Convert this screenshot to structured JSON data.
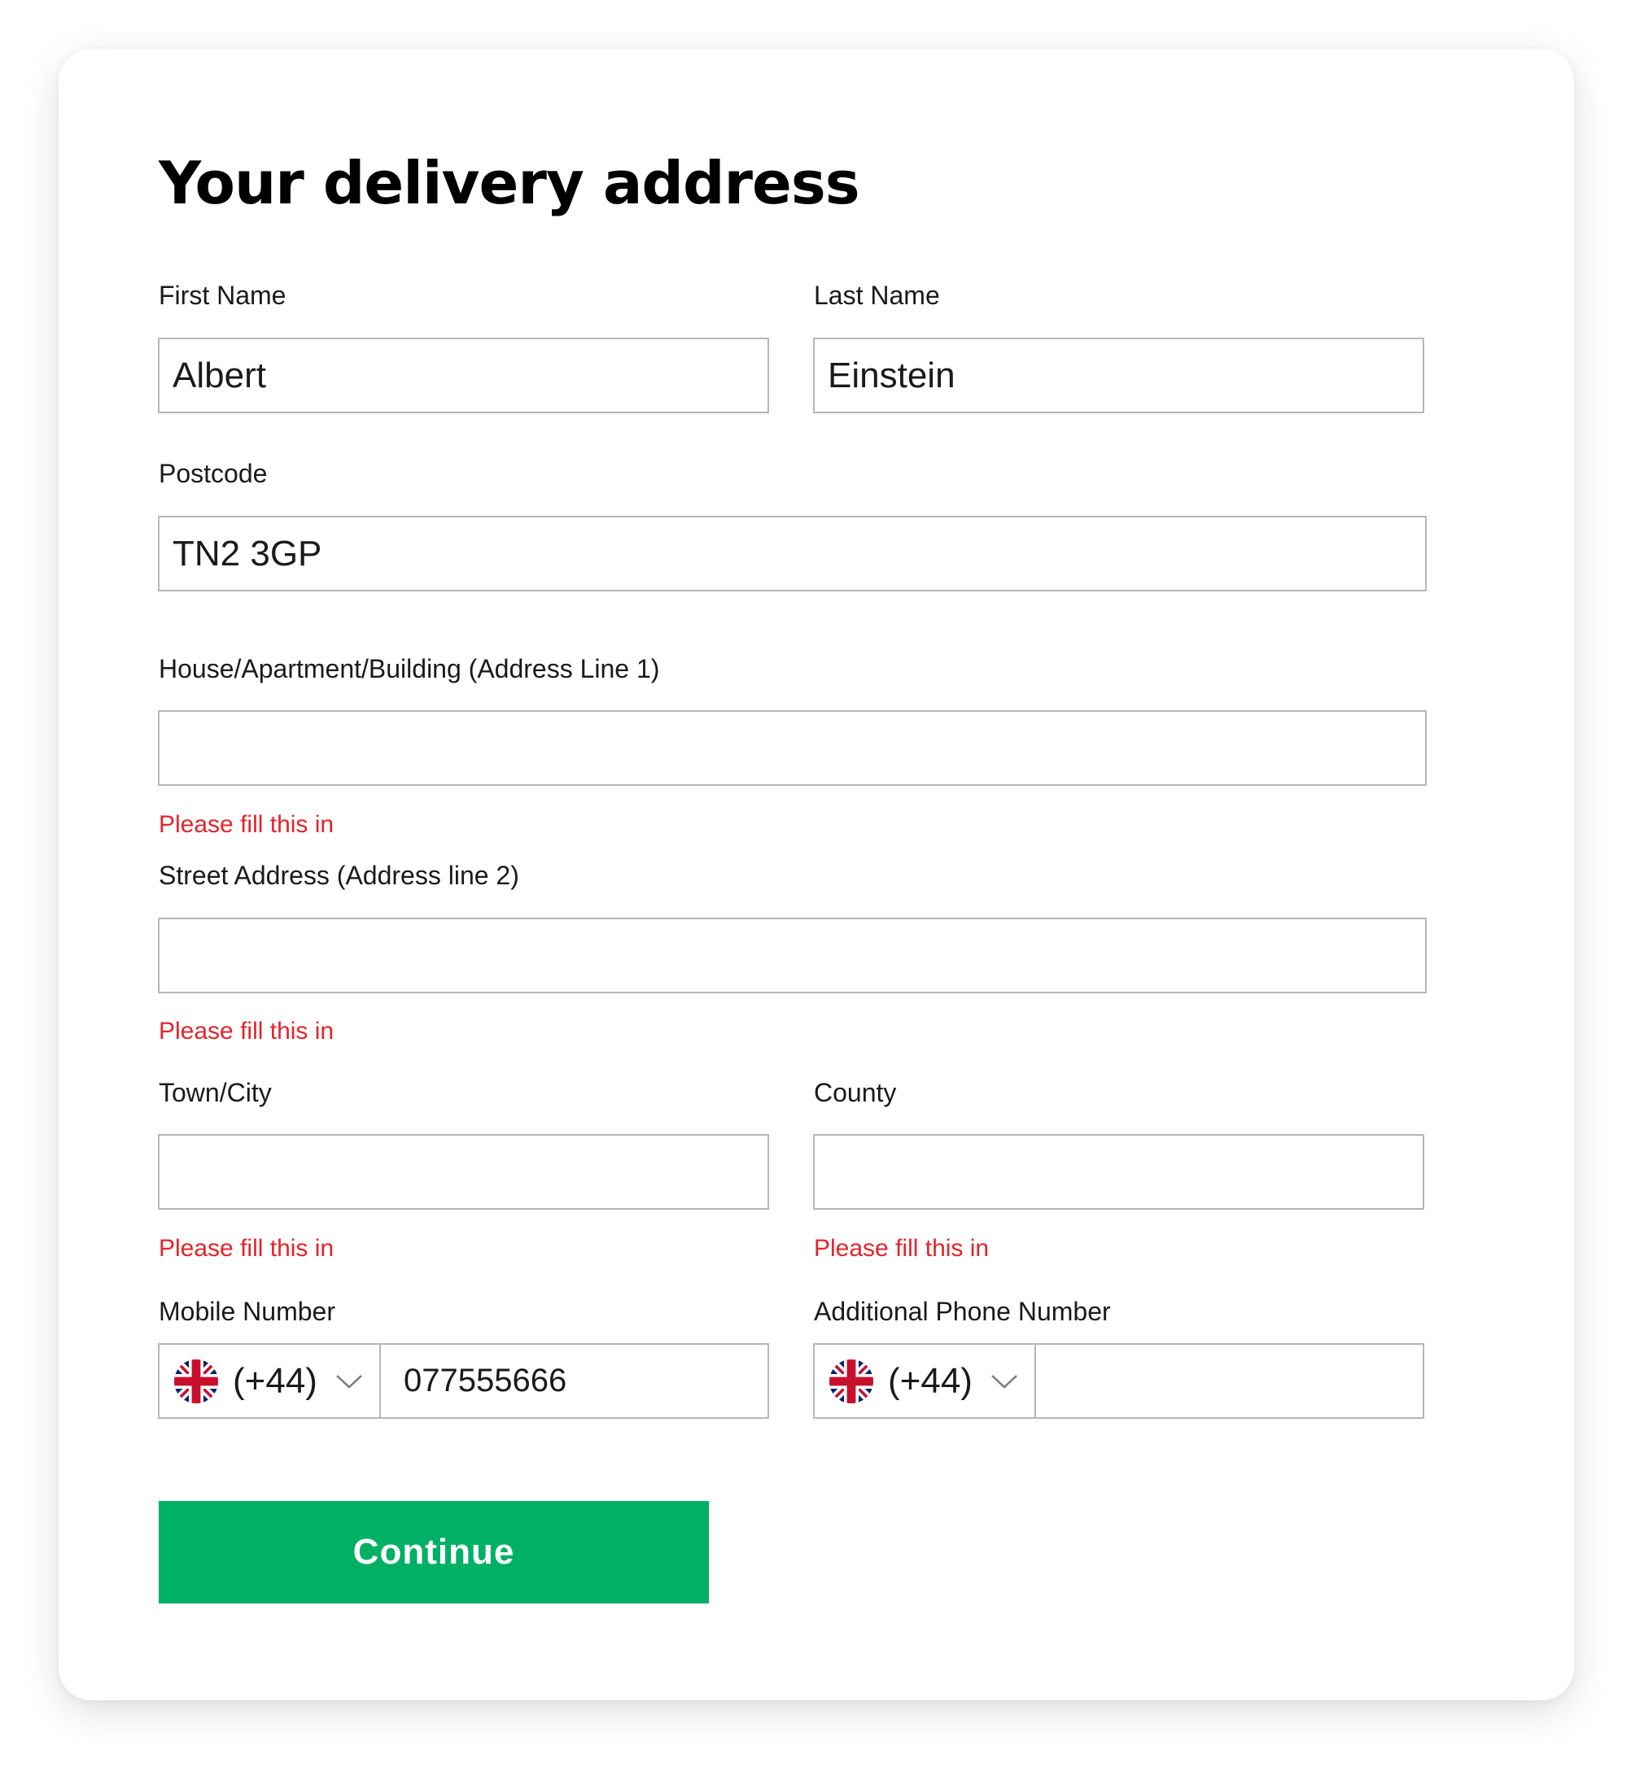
{
  "form": {
    "title": "Your delivery address",
    "error_text": "Please fill this in",
    "first_name": {
      "label": "First Name",
      "value": "Albert"
    },
    "last_name": {
      "label": "Last Name",
      "value": "Einstein"
    },
    "postcode": {
      "label": "Postcode",
      "value": "TN2 3GP"
    },
    "address_line1": {
      "label": "House/Apartment/Building (Address Line 1)",
      "value": ""
    },
    "address_line2": {
      "label": "Street Address (Address line 2)",
      "value": ""
    },
    "town": {
      "label": "Town/City",
      "value": ""
    },
    "county": {
      "label": "County",
      "value": ""
    },
    "mobile": {
      "label": "Mobile Number",
      "country_code": "(+44)",
      "flag_icon": "uk-flag-icon",
      "value": "077555666"
    },
    "additional_phone": {
      "label": "Additional Phone Number",
      "country_code": "(+44)",
      "flag_icon": "uk-flag-icon",
      "value": ""
    },
    "continue_label": "Continue",
    "colors": {
      "error": "#e3242b",
      "button": "#00b065",
      "border": "#b7b7b7"
    }
  }
}
